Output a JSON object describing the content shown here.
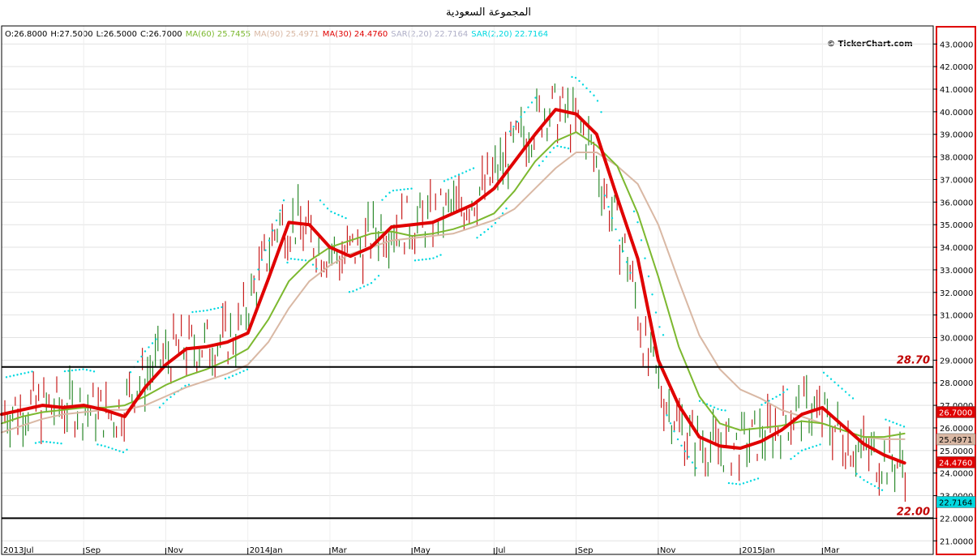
{
  "title": "المجموعة السعودية",
  "legend": [
    {
      "text": "O:26.8000",
      "color": "#000000"
    },
    {
      "text": "H:27.5000",
      "color": "#000000"
    },
    {
      "text": "L:26.5000",
      "color": "#000000"
    },
    {
      "text": "C:26.7000",
      "color": "#000000"
    },
    {
      "text": "MA(60) 25.7455",
      "color": "#7cb82f"
    },
    {
      "text": "MA(90) 25.4971",
      "color": "#d9b8a4"
    },
    {
      "text": "MA(30) 24.4760",
      "color": "#e00000"
    },
    {
      "text": "SAR(2,20) 22.7164",
      "color": "#b0b0c8"
    },
    {
      "text": "SAR(2,20) 22.7164",
      "color": "#00d8e0"
    }
  ],
  "watermark": "© TickerChart.com",
  "chart_data": {
    "type": "line",
    "ylim": [
      20.4,
      43.8
    ],
    "y_ticks": [
      "21.0000",
      "22.0000",
      "23.0000",
      "24.0000",
      "25.0000",
      "26.0000",
      "27.0000",
      "28.0000",
      "29.0000",
      "30.0000",
      "31.0000",
      "32.0000",
      "33.0000",
      "34.0000",
      "35.0000",
      "36.0000",
      "37.0000",
      "38.0000",
      "39.0000",
      "40.0000",
      "41.0000",
      "42.0000",
      "43.0000"
    ],
    "x_ticks": [
      "2013Jul",
      "Sep",
      "Nov",
      "2014Jan",
      "Mar",
      "May",
      "Jul",
      "Sep",
      "Nov",
      "2015Jan",
      "Mar"
    ],
    "x_tick_pos": [
      0,
      2,
      4,
      6,
      8,
      10,
      12,
      14,
      16,
      18,
      20
    ],
    "x_max": 22.7,
    "horizontal_lines": [
      {
        "value": 28.7,
        "label": "28.70",
        "color": "#000000"
      },
      {
        "value": 22.0,
        "label": "22.00",
        "color": "#000000"
      }
    ],
    "price_tags": [
      {
        "label": "26.7000",
        "value": 26.7,
        "color": "#e00000",
        "text_color": "#ffffff"
      },
      {
        "label": "25.4971",
        "value": 25.4971,
        "color": "#d9b8a4",
        "text_color": "#000000"
      },
      {
        "label": "24.4760",
        "value": 24.476,
        "color": "#e00000",
        "text_color": "#ffffff"
      },
      {
        "label": "22.7164",
        "value": 22.7164,
        "color": "#00d8e0",
        "text_color": "#000000"
      }
    ],
    "series": [
      {
        "name": "MA(30)",
        "color": "#e00000",
        "width": 4,
        "x": [
          0,
          0.5,
          1,
          1.5,
          2,
          2.5,
          3,
          3.5,
          4,
          4.5,
          5,
          5.5,
          6,
          6.5,
          7,
          7.5,
          8,
          8.5,
          9,
          9.5,
          10,
          10.5,
          11,
          11.5,
          12,
          12.5,
          13,
          13.5,
          14,
          14.5,
          15,
          15.5,
          16,
          16.5,
          17,
          17.5,
          18,
          18.5,
          19,
          19.5,
          20,
          20.5,
          21,
          21.5,
          22
        ],
        "values": [
          26.6,
          26.8,
          27.0,
          26.9,
          27.0,
          26.8,
          26.5,
          27.8,
          28.8,
          29.5,
          29.6,
          29.8,
          30.2,
          32.6,
          35.1,
          35.0,
          34.0,
          33.6,
          34.0,
          34.9,
          35.0,
          35.1,
          35.5,
          35.9,
          36.6,
          37.8,
          39.0,
          40.1,
          39.9,
          39.0,
          36.2,
          33.5,
          29.0,
          27.0,
          25.6,
          25.2,
          25.1,
          25.4,
          25.9,
          26.6,
          26.9,
          26.1,
          25.3,
          24.8,
          24.45
        ]
      },
      {
        "name": "MA(60)",
        "color": "#7cb82f",
        "width": 2,
        "x": [
          0,
          0.5,
          1,
          1.5,
          2,
          2.5,
          3,
          3.5,
          4,
          4.5,
          5,
          5.5,
          6,
          6.5,
          7,
          7.5,
          8,
          8.5,
          9,
          9.5,
          10,
          10.5,
          11,
          11.5,
          12,
          12.5,
          13,
          13.5,
          14,
          14.5,
          15,
          15.5,
          16,
          16.5,
          17,
          17.5,
          18,
          18.5,
          19,
          19.5,
          20,
          20.5,
          21,
          21.5,
          22
        ],
        "values": [
          26.2,
          26.5,
          26.7,
          26.8,
          26.9,
          26.9,
          27.0,
          27.4,
          27.9,
          28.3,
          28.6,
          29.0,
          29.5,
          30.8,
          32.5,
          33.4,
          34.0,
          34.3,
          34.6,
          34.7,
          34.5,
          34.6,
          34.8,
          35.1,
          35.5,
          36.5,
          37.8,
          38.7,
          39.1,
          38.5,
          37.6,
          35.5,
          32.7,
          29.6,
          27.4,
          26.2,
          25.9,
          26.0,
          26.1,
          26.3,
          26.2,
          25.9,
          25.6,
          25.6,
          25.75
        ]
      },
      {
        "name": "MA(90)",
        "color": "#d9b8a4",
        "width": 2,
        "x": [
          0,
          0.5,
          1,
          1.5,
          2,
          2.5,
          3,
          3.5,
          4,
          4.5,
          5,
          5.5,
          6,
          6.5,
          7,
          7.5,
          8,
          8.5,
          9,
          9.5,
          10,
          10.5,
          11,
          11.5,
          12,
          12.5,
          13,
          13.5,
          14,
          14.5,
          15,
          15.5,
          16,
          16.5,
          17,
          17.5,
          18,
          18.5,
          19,
          19.5,
          20,
          20.5,
          21,
          21.5,
          22
        ],
        "values": [
          25.8,
          26.1,
          26.4,
          26.6,
          26.7,
          26.8,
          26.8,
          27.0,
          27.4,
          27.8,
          28.1,
          28.4,
          28.8,
          29.8,
          31.3,
          32.5,
          33.2,
          33.7,
          34.0,
          34.3,
          34.4,
          34.5,
          34.6,
          34.9,
          35.2,
          35.7,
          36.6,
          37.5,
          38.2,
          38.2,
          37.6,
          36.8,
          35.0,
          32.5,
          30.1,
          28.6,
          27.7,
          27.3,
          26.8,
          26.5,
          26.2,
          25.9,
          25.6,
          25.5,
          25.5
        ]
      }
    ]
  }
}
